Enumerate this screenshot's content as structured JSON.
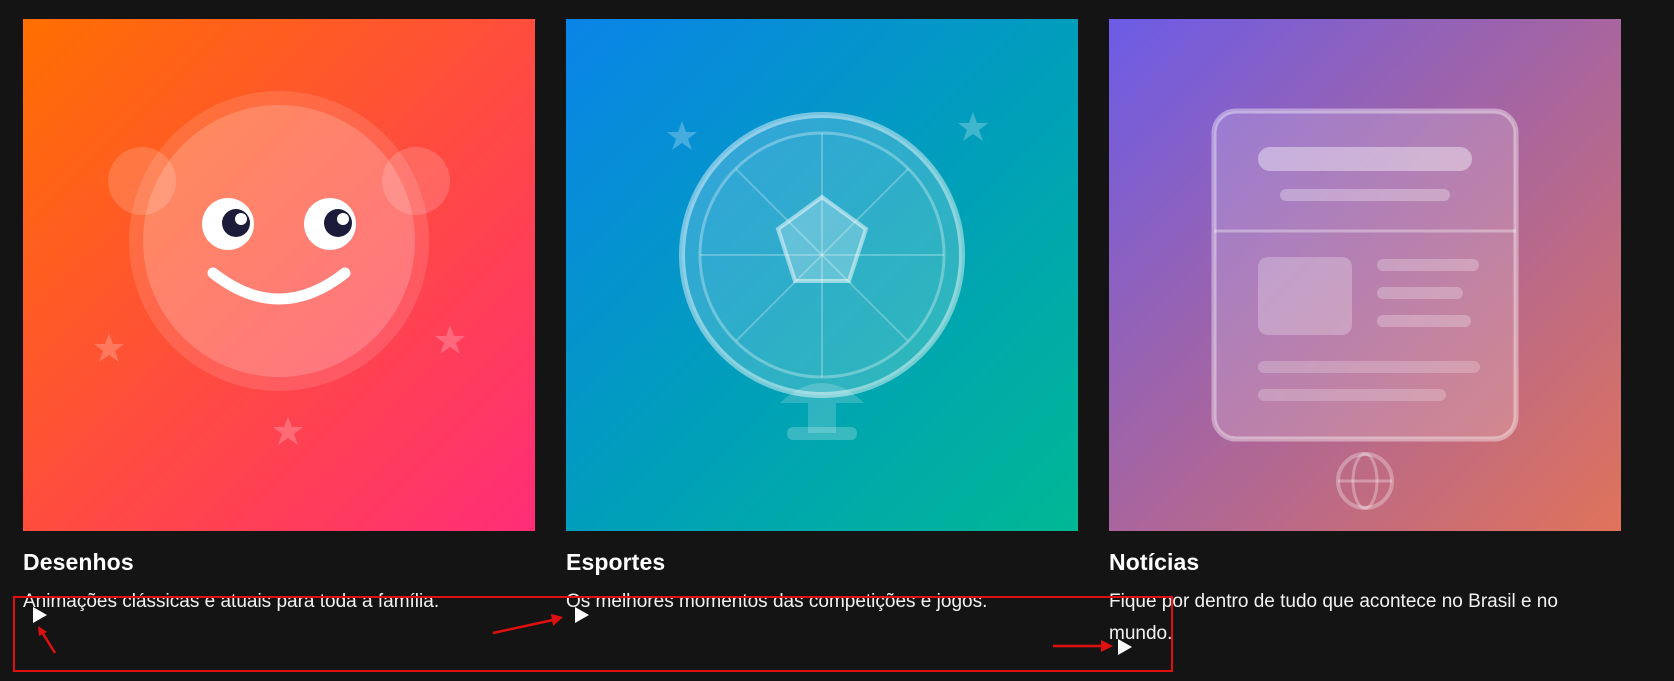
{
  "cards": [
    {
      "title": "Desenhos",
      "description": "Animações clássicas e atuais para toda a família.",
      "play_icon": "play-icon",
      "gradient": [
        "#ff6a00",
        "#ff2d7a"
      ]
    },
    {
      "title": "Esportes",
      "description": "Os melhores momentos das competições e jogos.",
      "play_icon": "play-icon",
      "gradient": [
        "#0b84e6",
        "#00b894"
      ]
    },
    {
      "title": "Notícias",
      "description": "Fique por dentro de tudo que acontece no Brasil e no mundo.",
      "play_icon": "play-icon",
      "gradient": [
        "#6c5ce7",
        "#e17055"
      ]
    }
  ],
  "annotation": {
    "box_color": "#e01010",
    "arrow_color": "#e01010"
  },
  "colors": {
    "background": "#141414",
    "text": "#ffffff"
  }
}
